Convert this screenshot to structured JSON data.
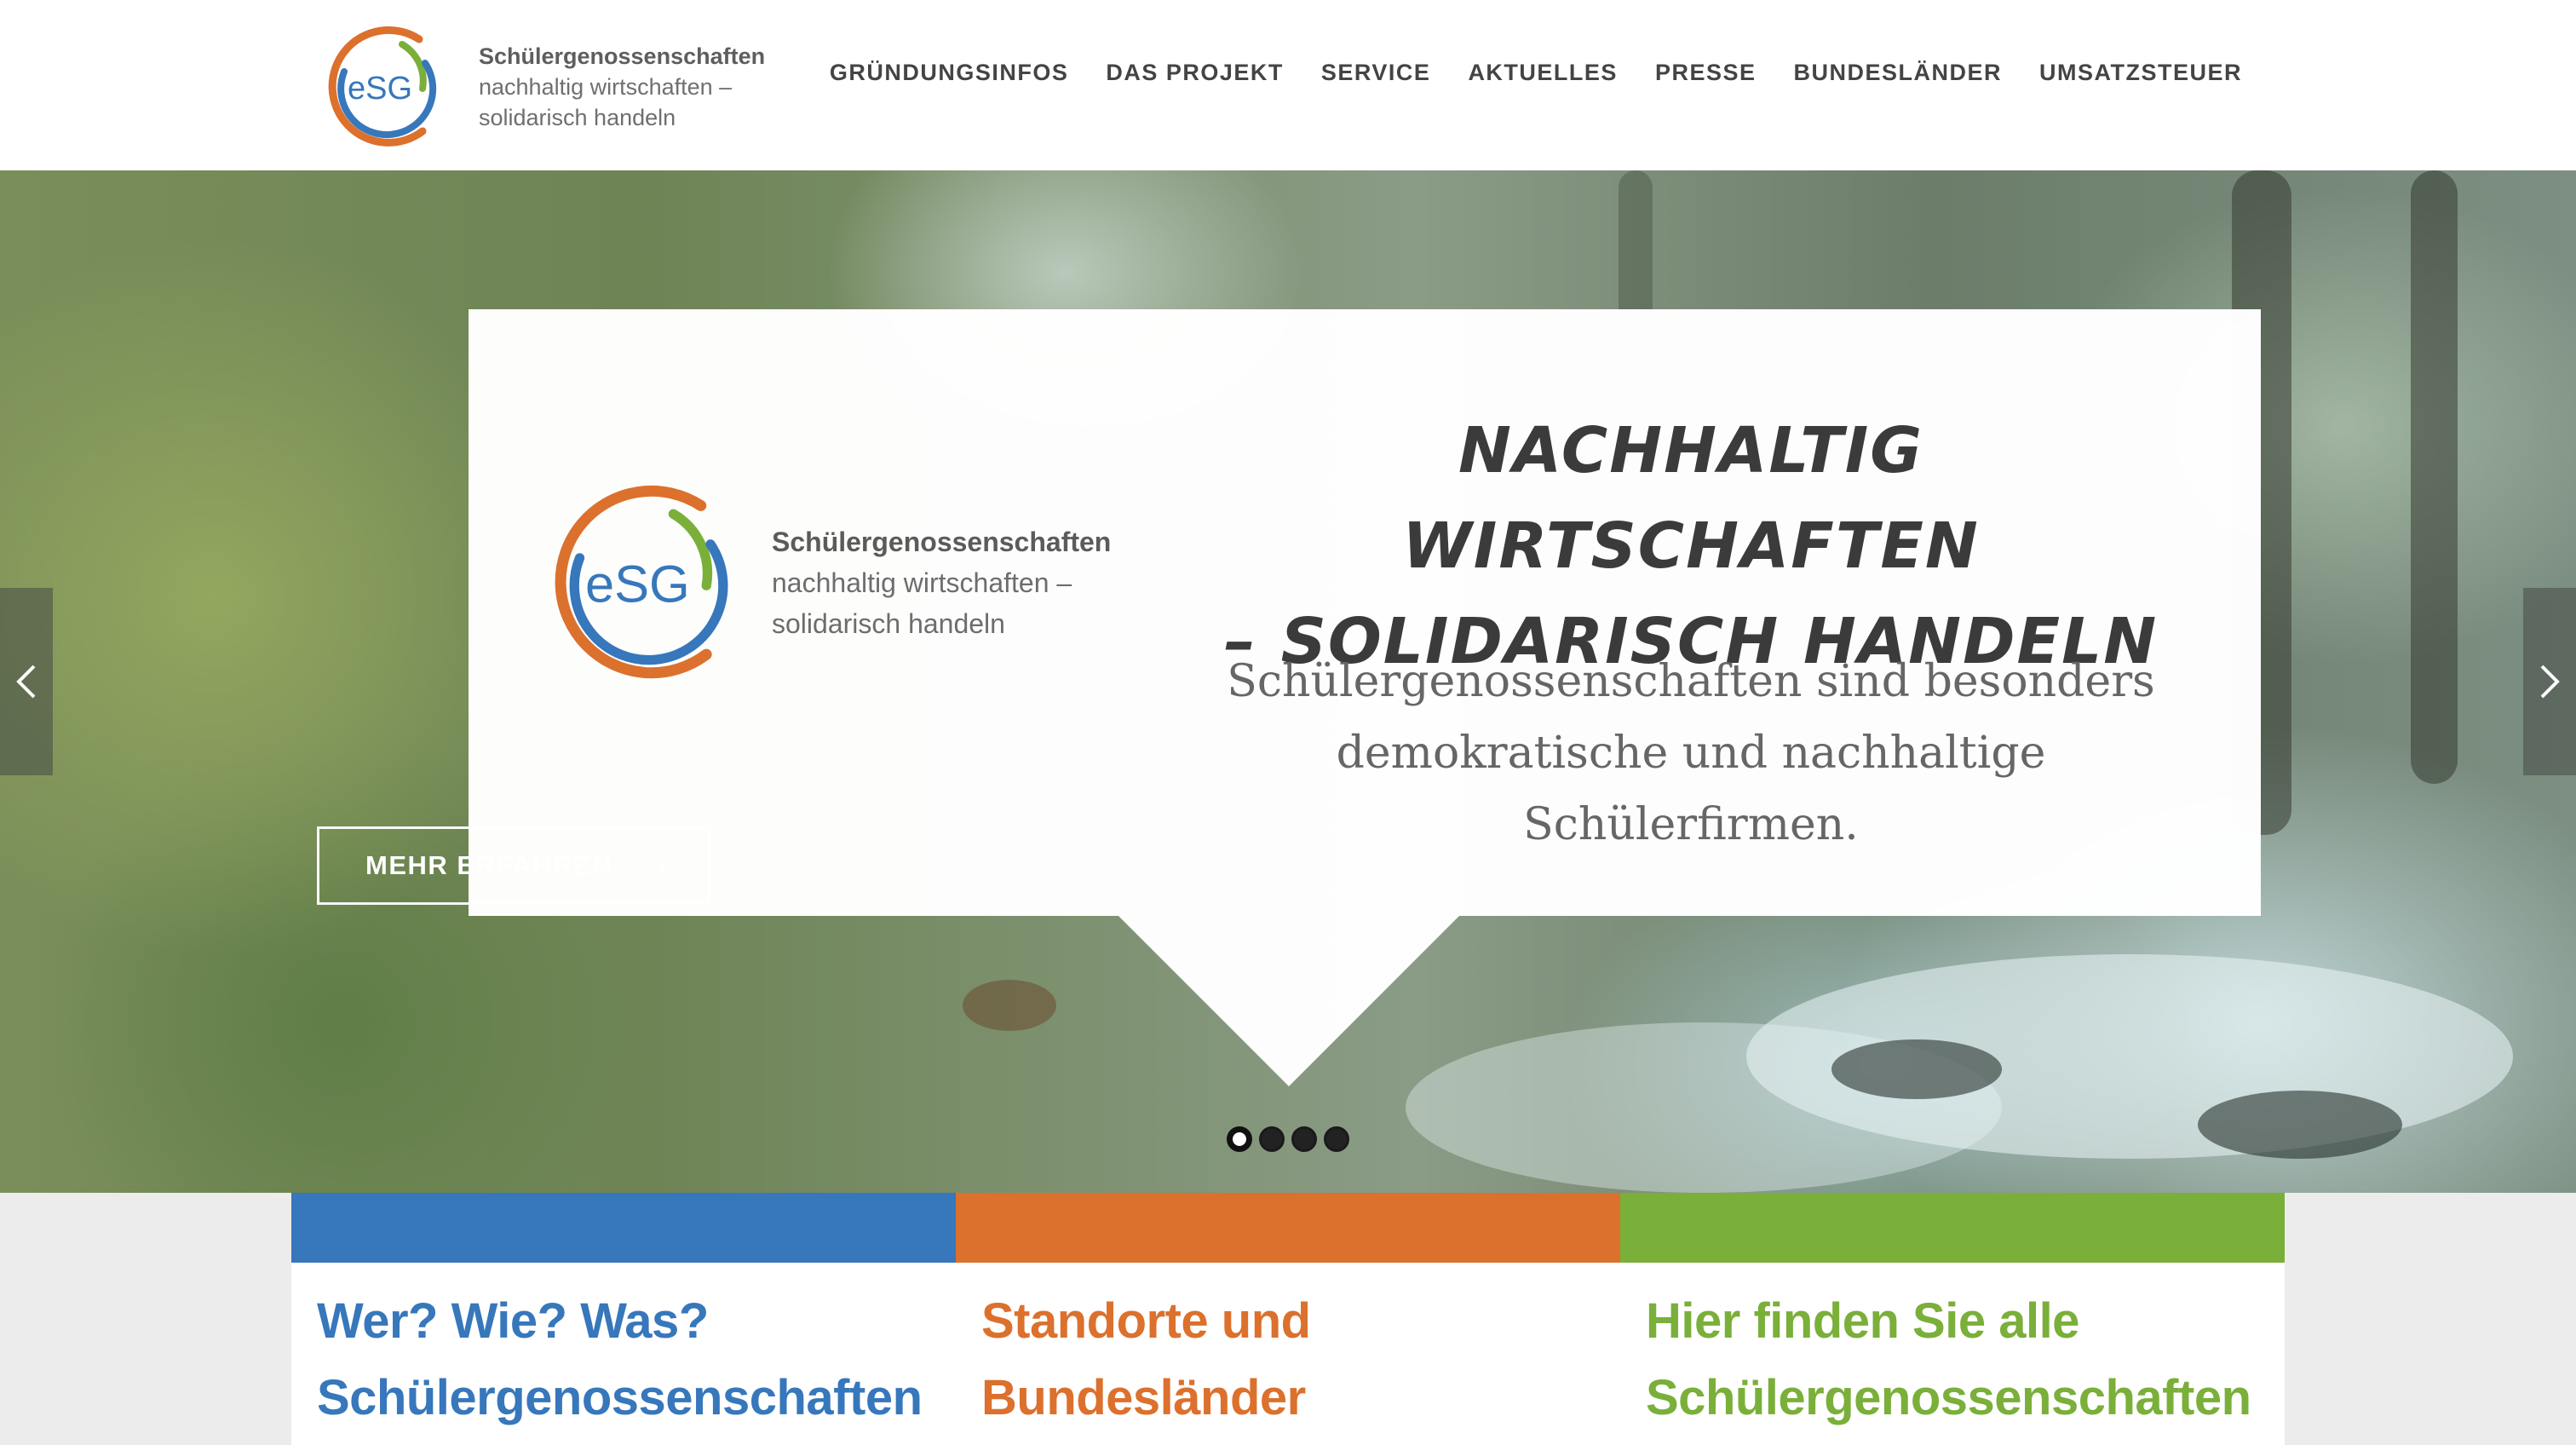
{
  "header": {
    "logo_mark_text": "eSG",
    "logo_line1": "Schülergenossenschaften",
    "logo_line2": "nachhaltig wirtschaften –",
    "logo_line3": "solidarisch handeln"
  },
  "nav": {
    "items": [
      {
        "label": "GRÜNDUNGSINFOS"
      },
      {
        "label": "DAS PROJEKT"
      },
      {
        "label": "SERVICE"
      },
      {
        "label": "AKTUELLES"
      },
      {
        "label": "PRESSE"
      },
      {
        "label": "BUNDESLÄNDER"
      },
      {
        "label": "UMSATZSTEUER"
      }
    ]
  },
  "hero": {
    "card": {
      "logo_mark_text": "eSG",
      "logo_line1": "Schülergenossenschaften",
      "logo_line2": "nachhaltig wirtschaften –",
      "logo_line3": "solidarisch handeln",
      "headline_line1": "NACHHALTIG WIRTSCHAFTEN",
      "headline_line2": "– SOLIDARISCH HANDELN",
      "subline_line1": "Schülergenossenschaften sind besonders",
      "subline_line2": "demokratische und nachhaltige",
      "subline_line3": "Schülerfirmen."
    },
    "cta_label": "MEHR ERFAHREN...",
    "cta_arrow": "›",
    "slides_total": 4,
    "active_slide": 1
  },
  "boxes": [
    {
      "title_line1": "Wer? Wie? Was?",
      "title_line2": "Schülergenossenschaften",
      "color": "#3777bb"
    },
    {
      "title_line1": "Standorte und",
      "title_line2": "Bundesländer",
      "color": "#dc702d"
    },
    {
      "title_line1": "Hier finden Sie alle",
      "title_line2": "Schülergenossenschaften",
      "color": "#7aaf3a"
    }
  ],
  "colors": {
    "blue": "#3777bb",
    "orange": "#dc702d",
    "green": "#7aaf3a",
    "nav_text": "#444444"
  },
  "icons": {
    "prev": "chevron-left-icon",
    "next": "chevron-right-icon"
  }
}
